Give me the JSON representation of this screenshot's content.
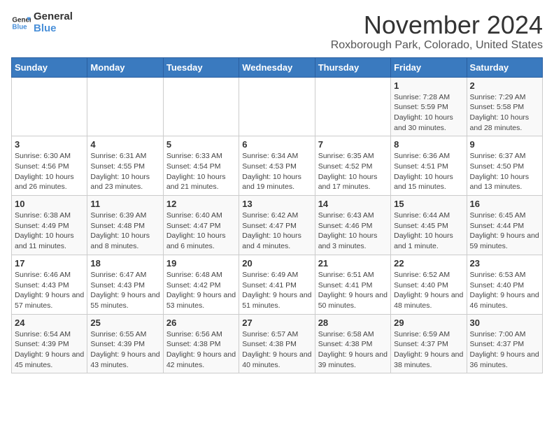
{
  "header": {
    "logo_general": "General",
    "logo_blue": "Blue",
    "title": "November 2024",
    "subtitle": "Roxborough Park, Colorado, United States"
  },
  "days_of_week": [
    "Sunday",
    "Monday",
    "Tuesday",
    "Wednesday",
    "Thursday",
    "Friday",
    "Saturday"
  ],
  "weeks": [
    [
      {
        "day": "",
        "info": ""
      },
      {
        "day": "",
        "info": ""
      },
      {
        "day": "",
        "info": ""
      },
      {
        "day": "",
        "info": ""
      },
      {
        "day": "",
        "info": ""
      },
      {
        "day": "1",
        "info": "Sunrise: 7:28 AM\nSunset: 5:59 PM\nDaylight: 10 hours and 30 minutes."
      },
      {
        "day": "2",
        "info": "Sunrise: 7:29 AM\nSunset: 5:58 PM\nDaylight: 10 hours and 28 minutes."
      }
    ],
    [
      {
        "day": "3",
        "info": "Sunrise: 6:30 AM\nSunset: 4:56 PM\nDaylight: 10 hours and 26 minutes."
      },
      {
        "day": "4",
        "info": "Sunrise: 6:31 AM\nSunset: 4:55 PM\nDaylight: 10 hours and 23 minutes."
      },
      {
        "day": "5",
        "info": "Sunrise: 6:33 AM\nSunset: 4:54 PM\nDaylight: 10 hours and 21 minutes."
      },
      {
        "day": "6",
        "info": "Sunrise: 6:34 AM\nSunset: 4:53 PM\nDaylight: 10 hours and 19 minutes."
      },
      {
        "day": "7",
        "info": "Sunrise: 6:35 AM\nSunset: 4:52 PM\nDaylight: 10 hours and 17 minutes."
      },
      {
        "day": "8",
        "info": "Sunrise: 6:36 AM\nSunset: 4:51 PM\nDaylight: 10 hours and 15 minutes."
      },
      {
        "day": "9",
        "info": "Sunrise: 6:37 AM\nSunset: 4:50 PM\nDaylight: 10 hours and 13 minutes."
      }
    ],
    [
      {
        "day": "10",
        "info": "Sunrise: 6:38 AM\nSunset: 4:49 PM\nDaylight: 10 hours and 11 minutes."
      },
      {
        "day": "11",
        "info": "Sunrise: 6:39 AM\nSunset: 4:48 PM\nDaylight: 10 hours and 8 minutes."
      },
      {
        "day": "12",
        "info": "Sunrise: 6:40 AM\nSunset: 4:47 PM\nDaylight: 10 hours and 6 minutes."
      },
      {
        "day": "13",
        "info": "Sunrise: 6:42 AM\nSunset: 4:47 PM\nDaylight: 10 hours and 4 minutes."
      },
      {
        "day": "14",
        "info": "Sunrise: 6:43 AM\nSunset: 4:46 PM\nDaylight: 10 hours and 3 minutes."
      },
      {
        "day": "15",
        "info": "Sunrise: 6:44 AM\nSunset: 4:45 PM\nDaylight: 10 hours and 1 minute."
      },
      {
        "day": "16",
        "info": "Sunrise: 6:45 AM\nSunset: 4:44 PM\nDaylight: 9 hours and 59 minutes."
      }
    ],
    [
      {
        "day": "17",
        "info": "Sunrise: 6:46 AM\nSunset: 4:43 PM\nDaylight: 9 hours and 57 minutes."
      },
      {
        "day": "18",
        "info": "Sunrise: 6:47 AM\nSunset: 4:43 PM\nDaylight: 9 hours and 55 minutes."
      },
      {
        "day": "19",
        "info": "Sunrise: 6:48 AM\nSunset: 4:42 PM\nDaylight: 9 hours and 53 minutes."
      },
      {
        "day": "20",
        "info": "Sunrise: 6:49 AM\nSunset: 4:41 PM\nDaylight: 9 hours and 51 minutes."
      },
      {
        "day": "21",
        "info": "Sunrise: 6:51 AM\nSunset: 4:41 PM\nDaylight: 9 hours and 50 minutes."
      },
      {
        "day": "22",
        "info": "Sunrise: 6:52 AM\nSunset: 4:40 PM\nDaylight: 9 hours and 48 minutes."
      },
      {
        "day": "23",
        "info": "Sunrise: 6:53 AM\nSunset: 4:40 PM\nDaylight: 9 hours and 46 minutes."
      }
    ],
    [
      {
        "day": "24",
        "info": "Sunrise: 6:54 AM\nSunset: 4:39 PM\nDaylight: 9 hours and 45 minutes."
      },
      {
        "day": "25",
        "info": "Sunrise: 6:55 AM\nSunset: 4:39 PM\nDaylight: 9 hours and 43 minutes."
      },
      {
        "day": "26",
        "info": "Sunrise: 6:56 AM\nSunset: 4:38 PM\nDaylight: 9 hours and 42 minutes."
      },
      {
        "day": "27",
        "info": "Sunrise: 6:57 AM\nSunset: 4:38 PM\nDaylight: 9 hours and 40 minutes."
      },
      {
        "day": "28",
        "info": "Sunrise: 6:58 AM\nSunset: 4:38 PM\nDaylight: 9 hours and 39 minutes."
      },
      {
        "day": "29",
        "info": "Sunrise: 6:59 AM\nSunset: 4:37 PM\nDaylight: 9 hours and 38 minutes."
      },
      {
        "day": "30",
        "info": "Sunrise: 7:00 AM\nSunset: 4:37 PM\nDaylight: 9 hours and 36 minutes."
      }
    ]
  ]
}
